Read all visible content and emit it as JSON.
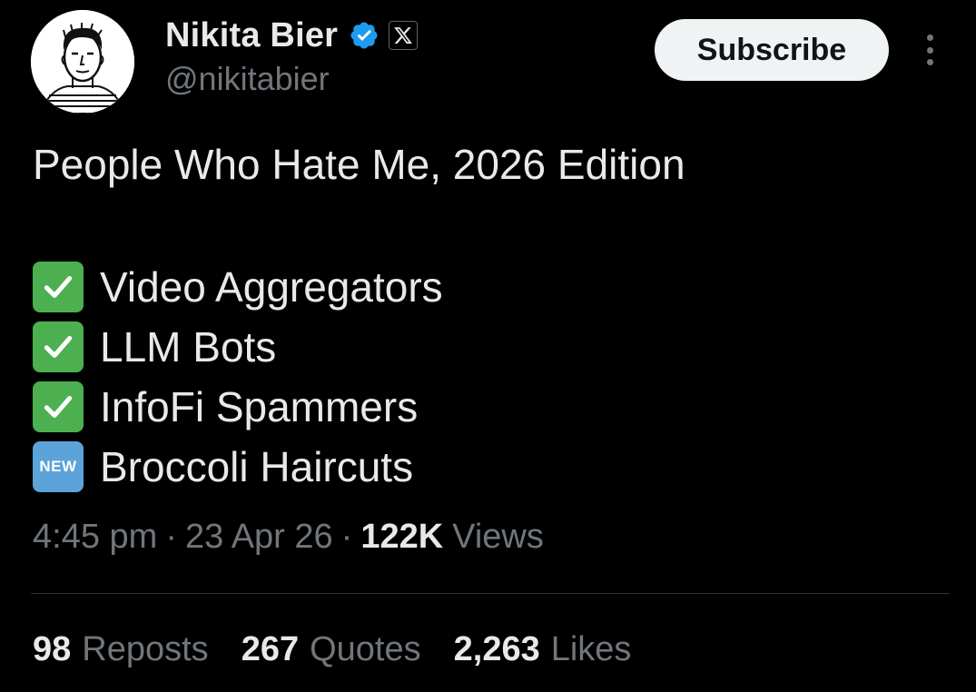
{
  "author": {
    "display_name": "Nikita Bier",
    "handle": "@nikitabier",
    "verified_icon": "verified-badge-icon",
    "affiliation_icon": "x-logo-icon",
    "avatar_icon": "avatar-sketch-portrait"
  },
  "actions": {
    "subscribe_label": "Subscribe",
    "more_icon": "more-vertical-icon"
  },
  "tweet": {
    "headline": "People Who Hate Me, 2026 Edition",
    "items": [
      {
        "icon": "check-mark-button-icon",
        "label": "Video Aggregators"
      },
      {
        "icon": "check-mark-button-icon",
        "label": "LLM Bots"
      },
      {
        "icon": "check-mark-button-icon",
        "label": "InfoFi Spammers"
      },
      {
        "icon": "new-button-icon",
        "icon_text": "NEW",
        "label": "Broccoli Haircuts"
      }
    ]
  },
  "meta": {
    "time": "4:45 pm",
    "separator": "·",
    "date": "23 Apr 26",
    "views_count": "122K",
    "views_label": "Views"
  },
  "stats": {
    "reposts_count": "98",
    "reposts_label": "Reposts",
    "quotes_count": "267",
    "quotes_label": "Quotes",
    "likes_count": "2,263",
    "likes_label": "Likes"
  },
  "colors": {
    "background": "#000000",
    "primary_text": "#e7e9ea",
    "secondary_text": "#71767b",
    "verified_blue": "#1d9bf0",
    "divider": "#2f3336",
    "button_bg": "#eff3f4",
    "check_green": "#4caf50",
    "new_blue": "#5ba3d8"
  }
}
